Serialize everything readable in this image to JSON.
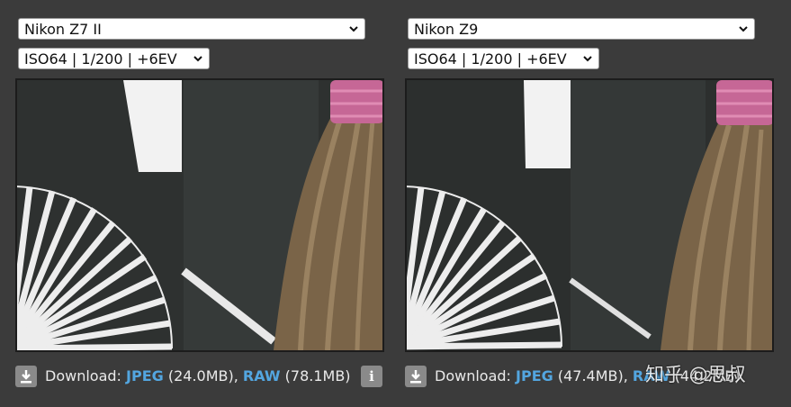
{
  "left": {
    "camera": "Nikon Z7 II",
    "setting": "ISO64 | 1/200 | +6EV",
    "download_prefix": "Download: ",
    "jpeg_label": "JPEG",
    "jpeg_size": " (24.0MB), ",
    "raw_label": "RAW",
    "raw_size": " (78.1MB)",
    "info_glyph": "i"
  },
  "right": {
    "camera": "Nikon Z9",
    "setting": "ISO64 | 1/200 | +6EV",
    "download_prefix": "Download: ",
    "jpeg_label": "JPEG",
    "jpeg_size": " (47.4MB), ",
    "raw_label": "RAW",
    "raw_size": " (44.2MB)"
  },
  "watermark": "知乎 @思叔",
  "colors": {
    "background": "#3b3b3b",
    "link": "#53a6e0"
  }
}
